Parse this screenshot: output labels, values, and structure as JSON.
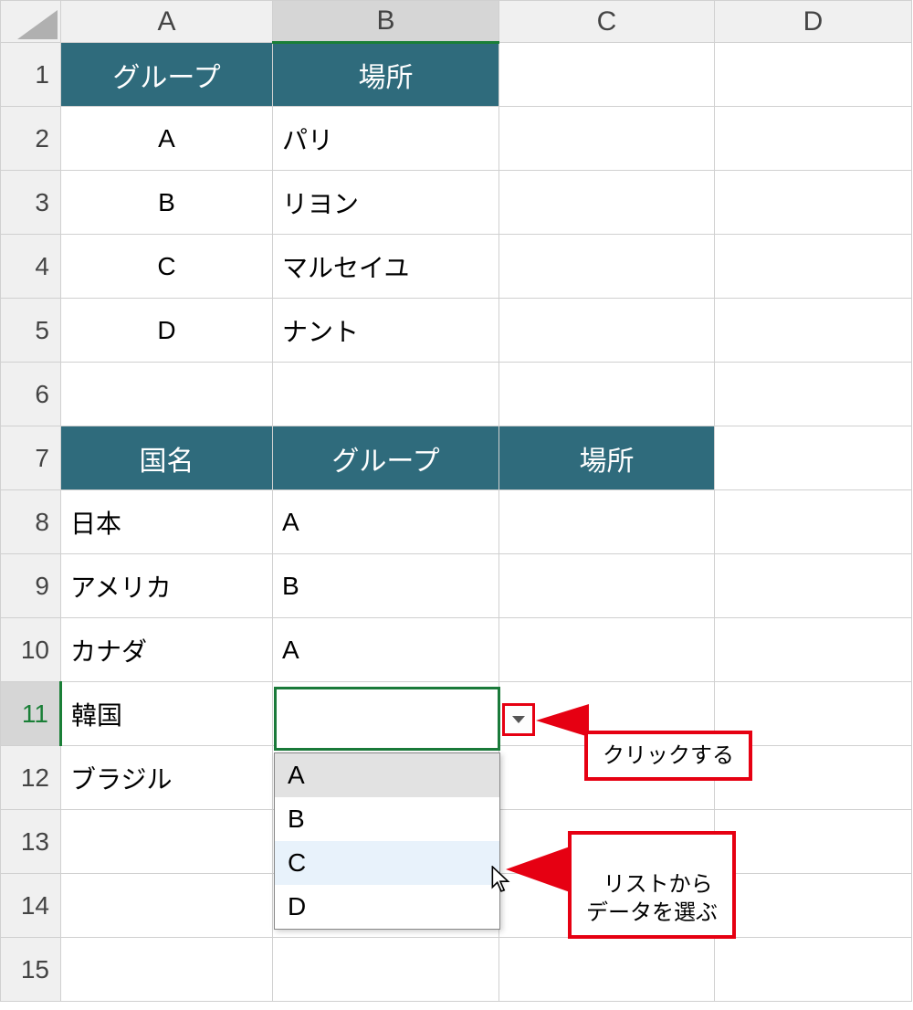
{
  "columns": [
    "A",
    "B",
    "C",
    "D"
  ],
  "rows": [
    "1",
    "2",
    "3",
    "4",
    "5",
    "6",
    "7",
    "8",
    "9",
    "10",
    "11",
    "12",
    "13",
    "14",
    "15"
  ],
  "selectedCol": "B",
  "selectedRow": "11",
  "table1": {
    "headers": {
      "a": "グループ",
      "b": "場所"
    },
    "rows": [
      {
        "a": "A",
        "b": "パリ"
      },
      {
        "a": "B",
        "b": "リヨン"
      },
      {
        "a": "C",
        "b": "マルセイユ"
      },
      {
        "a": "D",
        "b": "ナント"
      }
    ]
  },
  "table2": {
    "headers": {
      "a": "国名",
      "b": "グループ",
      "c": "場所"
    },
    "rows": [
      {
        "a": "日本",
        "b": "A",
        "c": ""
      },
      {
        "a": "アメリカ",
        "b": "B",
        "c": ""
      },
      {
        "a": "カナダ",
        "b": "A",
        "c": ""
      },
      {
        "a": "韓国",
        "b": "",
        "c": ""
      },
      {
        "a": "ブラジル",
        "b": "",
        "c": ""
      }
    ]
  },
  "dropdown": {
    "options": [
      "A",
      "B",
      "C",
      "D"
    ],
    "selectedIndex": 0,
    "hoverIndex": 2
  },
  "callouts": {
    "click": "クリックする",
    "pick": "リストから\nデータを選ぶ"
  }
}
